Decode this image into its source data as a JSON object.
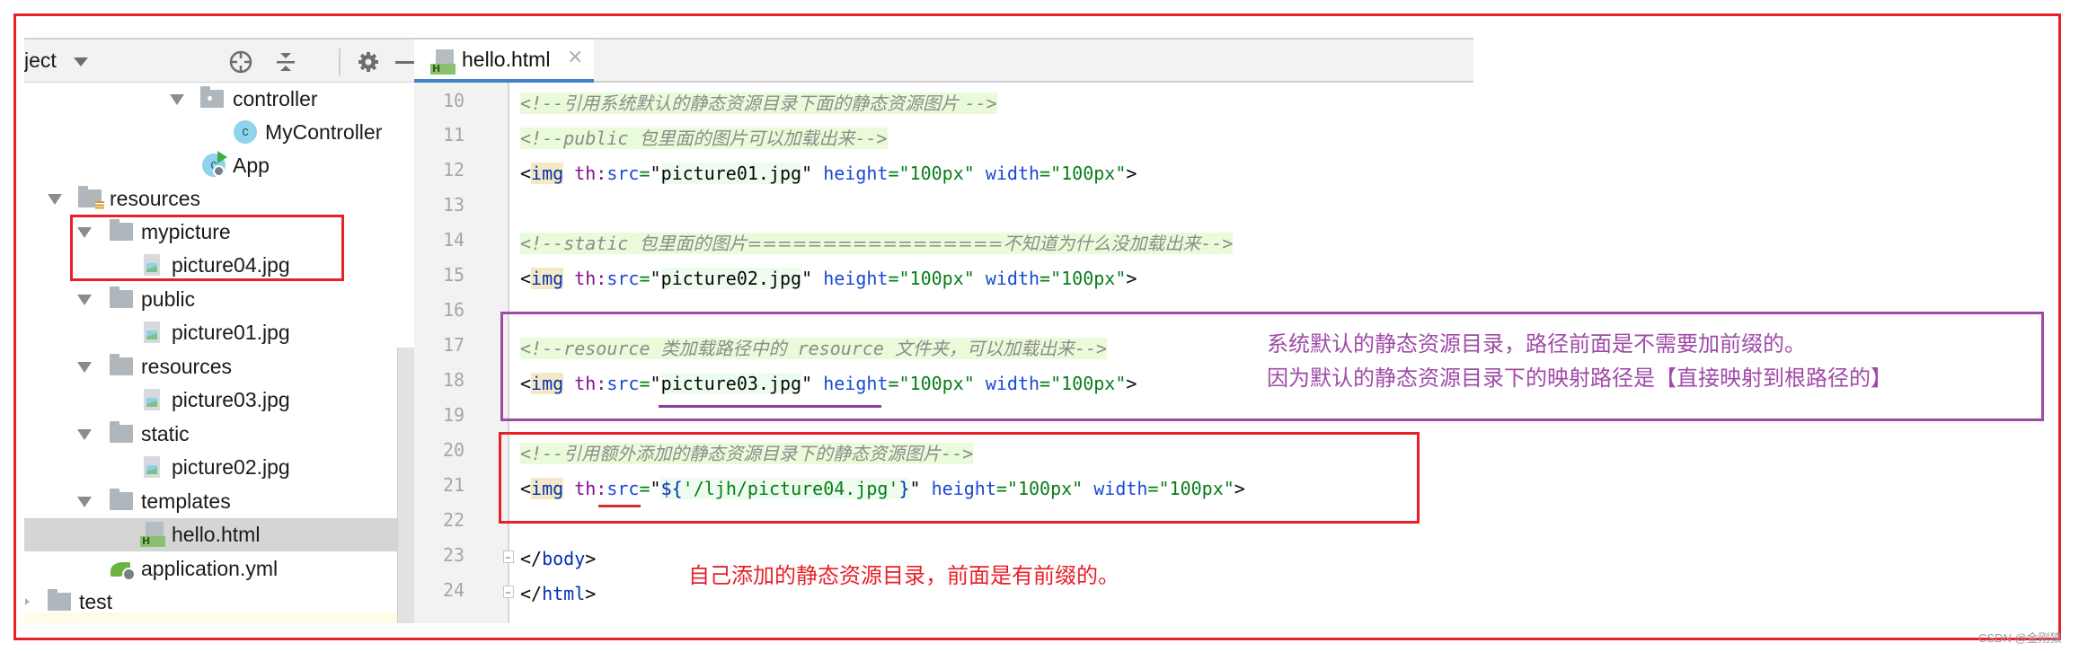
{
  "project_panel": {
    "title": "ject",
    "header_icons": [
      "locate-icon",
      "collapse-all-icon",
      "gear-icon",
      "minimize-icon"
    ],
    "tree": [
      {
        "label": "controller",
        "icon": "package-folder-icon",
        "expanded": true
      },
      {
        "label": "MyController",
        "icon": "class-icon",
        "icon_letter": "c"
      },
      {
        "label": "App",
        "icon": "spring-app-icon",
        "icon_letter": "c"
      },
      {
        "label": "resources",
        "icon": "resources-folder-icon",
        "expanded": true
      },
      {
        "label": "mypicture",
        "icon": "folder-icon",
        "expanded": true
      },
      {
        "label": "picture04.jpg",
        "icon": "image-file-icon"
      },
      {
        "label": "public",
        "icon": "folder-icon",
        "expanded": true
      },
      {
        "label": "picture01.jpg",
        "icon": "image-file-icon"
      },
      {
        "label": "resources",
        "icon": "folder-icon",
        "expanded": true
      },
      {
        "label": "picture03.jpg",
        "icon": "image-file-icon"
      },
      {
        "label": "static",
        "icon": "folder-icon",
        "expanded": true
      },
      {
        "label": "picture02.jpg",
        "icon": "image-file-icon"
      },
      {
        "label": "templates",
        "icon": "folder-icon",
        "expanded": true
      },
      {
        "label": "hello.html",
        "icon": "html-file-icon",
        "selected": true
      },
      {
        "label": "application.yml",
        "icon": "spring-yml-icon"
      },
      {
        "label": "test",
        "icon": "folder-icon",
        "expanded": false
      }
    ]
  },
  "editor": {
    "tab": {
      "label": "hello.html",
      "icon_letter": "H",
      "close": "×"
    },
    "line_numbers": [
      "10",
      "11",
      "12",
      "13",
      "14",
      "15",
      "16",
      "17",
      "18",
      "19",
      "20",
      "21",
      "22",
      "23",
      "24"
    ],
    "lines": {
      "l10": {
        "open": "<!--",
        "text": "引用系统默认的静态资源目录下面的静态资源图片 ",
        "close": "-->"
      },
      "l11": {
        "open": "<!--public ",
        "text": "包里面的图片可以加载出来",
        "close": "-->"
      },
      "l12": {
        "lt": "<",
        "tag": "img",
        "ns": "th:",
        "attr": "src",
        "eq": "=",
        "q1": "\"",
        "value": "picture01.jpg",
        "q2": "\"",
        "rest_attr1": " height",
        "rest_val1": "=\"100px\"",
        "rest_attr2": " width",
        "rest_val2": "=\"100px\"",
        "gt": ">"
      },
      "l14": {
        "open": "<!--static ",
        "text": "包里面的图片=================不知道为什么没加载出来",
        "close": "-->"
      },
      "l15": {
        "lt": "<",
        "tag": "img",
        "ns": "th:",
        "attr": "src",
        "eq": "=",
        "q1": "\"",
        "value": "picture02.jpg",
        "q2": "\"",
        "rest_attr1": " height",
        "rest_val1": "=\"100px\"",
        "rest_attr2": " width",
        "rest_val2": "=\"100px\"",
        "gt": ">"
      },
      "l17": {
        "open": "<!--resource ",
        "text1": "类加载路径中的",
        "mid": " resource ",
        "text2": "文件夹，可以加载出来",
        "close": "-->"
      },
      "l18": {
        "lt": "<",
        "tag": "img",
        "ns": "th:",
        "attr": "src",
        "eq": "=",
        "q1": "\"",
        "value": "picture03.jpg",
        "q2": "\"",
        "rest_attr1": " height",
        "rest_val1": "=\"100px\"",
        "rest_attr2": " width",
        "rest_val2": "=\"100px\"",
        "gt": ">"
      },
      "l20": {
        "open": "<!--",
        "text": "引用额外添加的静态资源目录下的静态资源图片",
        "close": "-->"
      },
      "l21": {
        "lt": "<",
        "tag": "img",
        "ns": "th:",
        "attr": "src",
        "eq": "=",
        "q1": "\"",
        "expr_open": "${",
        "expr_str": "'/ljh/picture04.jpg'",
        "expr_close": "}",
        "q2": "\"",
        "rest_attr1": " height",
        "rest_val1": "=\"100px\"",
        "rest_attr2": " width",
        "rest_val2": "=\"100px\"",
        "gt": ">"
      },
      "l23": {
        "open": "</",
        "tag": "body",
        "close": ">"
      },
      "l24": {
        "open": "</",
        "tag": "html",
        "close": ">"
      }
    }
  },
  "annotations": {
    "purple_note_line1": "系统默认的静态资源目录，路径前面是不需要加前缀的。",
    "purple_note_line2": "因为默认的静态资源目录下的映射路径是【直接映射到根路径的】",
    "red_note": "自己添加的静态资源目录，前面是有前缀的。",
    "colors": {
      "red": "#e8202a",
      "purple": "#a04aa8"
    }
  },
  "watermark": "CSDN @金刚猿"
}
